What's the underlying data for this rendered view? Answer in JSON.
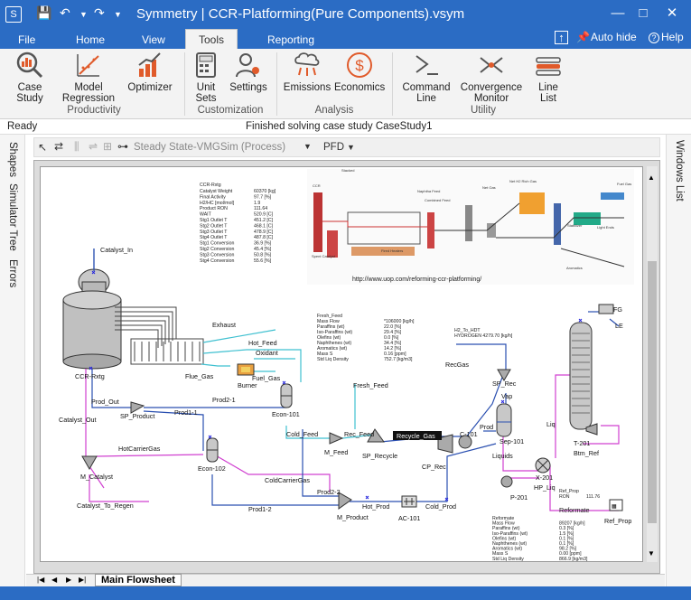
{
  "window": {
    "title": "Symmetry | CCR-Platforming(Pure Components).vsym",
    "minimize": "—",
    "maximize": "□",
    "close": "✕"
  },
  "tabs": {
    "file": "File",
    "home": "Home",
    "view": "View",
    "tools": "Tools",
    "reporting": "Reporting",
    "autohide": "Auto hide",
    "help": "Help"
  },
  "ribbon": {
    "case_study": "Case Study",
    "model_regression": "Model Regression",
    "optimizer": "Optimizer",
    "unit_sets": "Unit Sets",
    "settings": "Settings",
    "emissions": "Emissions",
    "economics": "Economics",
    "command_line": "Command Line",
    "convergence_monitor": "Convergence Monitor",
    "line_list": "Line List",
    "group_productivity": "Productivity",
    "group_customization": "Customization",
    "group_analysis": "Analysis",
    "group_utility": "Utility"
  },
  "status": {
    "ready": "Ready",
    "message": "Finished solving case study CaseStudy1"
  },
  "side": {
    "shapes": "Shapes",
    "simulator_tree": "Simulator Tree",
    "errors": "Errors",
    "windows_list": "Windows List"
  },
  "flowsheet_toolbar": {
    "mode": "Steady State-VMGSim (Process)",
    "pfd": "PFD"
  },
  "sheet_tab": "Main Flowsheet",
  "flowsheet": {
    "catalyst_in": "Catalyst_In",
    "ccr_rxtg": "CCR-Rxtg",
    "exhaust": "Exhaust",
    "hot_feed": "Hot_Feed",
    "oxidant": "Oxidant",
    "flue_gas": "Flue_Gas",
    "fuel_gas": "Fuel_Gas",
    "burner": "Burner",
    "prod2_1": "Prod2-1",
    "prod_out": "Prod_Out",
    "sp_product": "SP_Product",
    "catalyst_out": "Catalyst_Out",
    "prod1_1": "Prod1-1",
    "econ_101": "Econ-101",
    "cold_feed": "Cold_Feed",
    "hot_carrier_gas": "HotCarrierGas",
    "econ_102": "Econ-102",
    "m_catalyst": "M_Catalyst",
    "cold_carrier_gas": "ColdCarrierGas",
    "catalyst_to_regen": "Catalyst_To_Regen",
    "prod1_2": "Prod1-2",
    "prod2_2": "Prod2-2",
    "m_product": "M_Product",
    "hot_prod": "Hot_Prod",
    "ac_101": "AC-101",
    "cold_prod": "Cold_Prod",
    "fresh_feed": "Fresh_Feed",
    "rec_feed": "Rec_Feed",
    "m_feed": "M_Feed",
    "sp_recycle": "SP_Recycle",
    "recycle_gas": "Recycle_Gas",
    "cp_rec": "CP_Rec",
    "c_101": "C-101",
    "rec_gas": "RecGas",
    "sp_rec": "SP_Rec",
    "vap": "Vap",
    "sep_101": "Sep-101",
    "prod": "Prod",
    "liquids": "Liquids",
    "x_201": "X-201",
    "hp_liq": "HP_Liq",
    "p_201": "P-201",
    "liq": "Liq",
    "btm_ref": "Btm_Ref",
    "t_201": "T-201",
    "fg": "FG",
    "le": "LE",
    "h2_to_hdt": "H2_To_HDT",
    "reformate": "Reformate",
    "ref_prop": "Ref_Prop",
    "url": "http://www.uop.com/reforming-ccr-platforming/"
  },
  "tables": {
    "reactor": [
      [
        "Catalyst Weight",
        "60370 [kg]"
      ],
      [
        "Final Activity",
        "97.7 [%]"
      ],
      [
        "H2/HC [mol/mol]",
        "1.9"
      ],
      [
        "Product RON",
        "111.64"
      ],
      [
        "WAIT",
        "520.9 [C]"
      ],
      [
        "Stg1 Outlet T",
        "451.2 [C]"
      ],
      [
        "Stg2 Outlet T",
        "468.1 [C]"
      ],
      [
        "Stg3 Outlet T",
        "478.9 [C]"
      ],
      [
        "Stg4 Outlet T",
        "487.8 [C]"
      ],
      [
        "Stg1 Conversion",
        "36.9 [%]"
      ],
      [
        "Stg2 Conversion",
        "45.4 [%]"
      ],
      [
        "Stg3 Conversion",
        "50.8 [%]"
      ],
      [
        "Stg4 Conversion",
        "55.6 [%]"
      ]
    ],
    "fresh_feed": [
      [
        "Mass Flow",
        "*106000 [kg/h]"
      ],
      [
        "Paraffins (wt)",
        "22.0 [%]"
      ],
      [
        "Iso-Paraffins (wt)",
        "29.4 [%]"
      ],
      [
        "Olefins (wt)",
        "0.0 [%]"
      ],
      [
        "Naphthenes (wt)",
        "34.4 [%]"
      ],
      [
        "Aromatics (wt)",
        "14.2 [%]"
      ],
      [
        "Mass S",
        "0.16 [ppm]"
      ],
      [
        "Std Liq Density",
        "752.7 [kg/m3]"
      ]
    ],
    "h2_label": "HYDROGEN 4279.70 [kg/h]",
    "ref_prop": [
      [
        "Ref_Prop",
        ""
      ],
      [
        "RON",
        "111.76"
      ]
    ],
    "reformate": [
      [
        "Reformate",
        ""
      ],
      [
        "Mass Flow",
        "89207 [kg/h]"
      ],
      [
        "Paraffins (wt)",
        "0.3 [%]"
      ],
      [
        "Iso-Paraffins (wt)",
        "1.5 [%]"
      ],
      [
        "Olefins (wt)",
        "0.1 [%]"
      ],
      [
        "Naphthenes (wt)",
        "0.1 [%]"
      ],
      [
        "Aromatics (wt)",
        "98.2 [%]"
      ],
      [
        "Mass S",
        "0.00 [ppm]"
      ],
      [
        "Std Liq Density",
        "866.9 [kg/m3]"
      ]
    ]
  },
  "colors": {
    "accent": "#2b6cc4",
    "stream_blue": "#2a4fb0",
    "stream_cyan": "#3fc0d0",
    "stream_magenta": "#d040d0"
  }
}
